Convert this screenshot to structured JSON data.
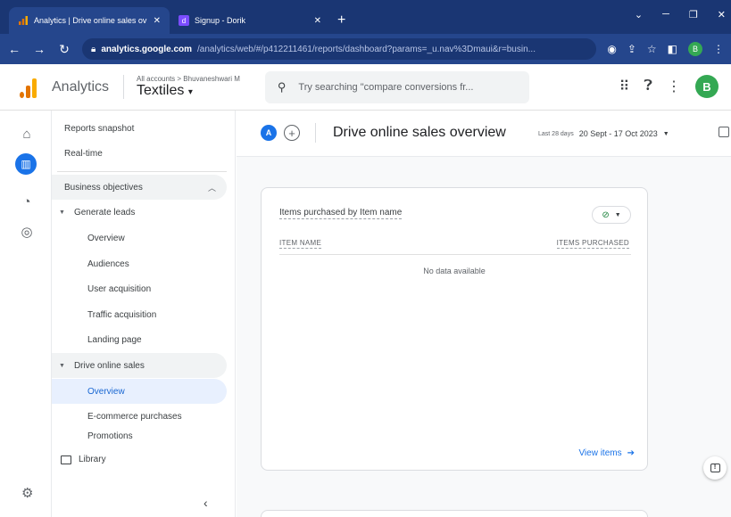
{
  "browser": {
    "tabs": [
      {
        "title": "Analytics | Drive online sales ov",
        "active": true,
        "favicon": "analytics-favicon"
      },
      {
        "title": "Signup - Dorik",
        "active": false,
        "favicon": "dorik-favicon"
      }
    ],
    "new_tab": "+",
    "address": {
      "host": "analytics.google.com",
      "path": "/analytics/web/#/p412211461/reports/dashboard?params=_u.nav%3Dmaui&r=busin..."
    }
  },
  "header": {
    "app_name": "Analytics",
    "breadcrumb": "All accounts > Bhuvaneshwari M",
    "property": "Textiles",
    "search_placeholder": "Try searching \"compare conversions fr...",
    "avatar_letter": "B"
  },
  "sidenav": {
    "items": [
      {
        "label": "Reports snapshot"
      },
      {
        "label": "Real-time"
      }
    ],
    "section_label": "Business objectives",
    "groups": [
      {
        "label": "Generate leads",
        "children": [
          "Overview",
          "Audiences",
          "User acquisition",
          "Traffic acquisition",
          "Landing page"
        ]
      },
      {
        "label": "Drive online sales",
        "children": [
          "Overview",
          "E-commerce purchases",
          "Promotions"
        ]
      }
    ],
    "library_label": "Library"
  },
  "main": {
    "comparison_chip": "A",
    "title": "Drive online sales overview",
    "date_label": "Last 28 days",
    "date_range": "20 Sept - 17 Oct 2023",
    "card": {
      "title": "Items purchased by Item name",
      "columns": [
        "ITEM NAME",
        "ITEMS PURCHASED"
      ],
      "empty_text": "No data available",
      "link_text": "View items"
    }
  },
  "colors": {
    "accent": "#1a73e8",
    "chrome_dark": "#1a3673",
    "chrome": "#25468c",
    "status_ok": "#188038"
  }
}
